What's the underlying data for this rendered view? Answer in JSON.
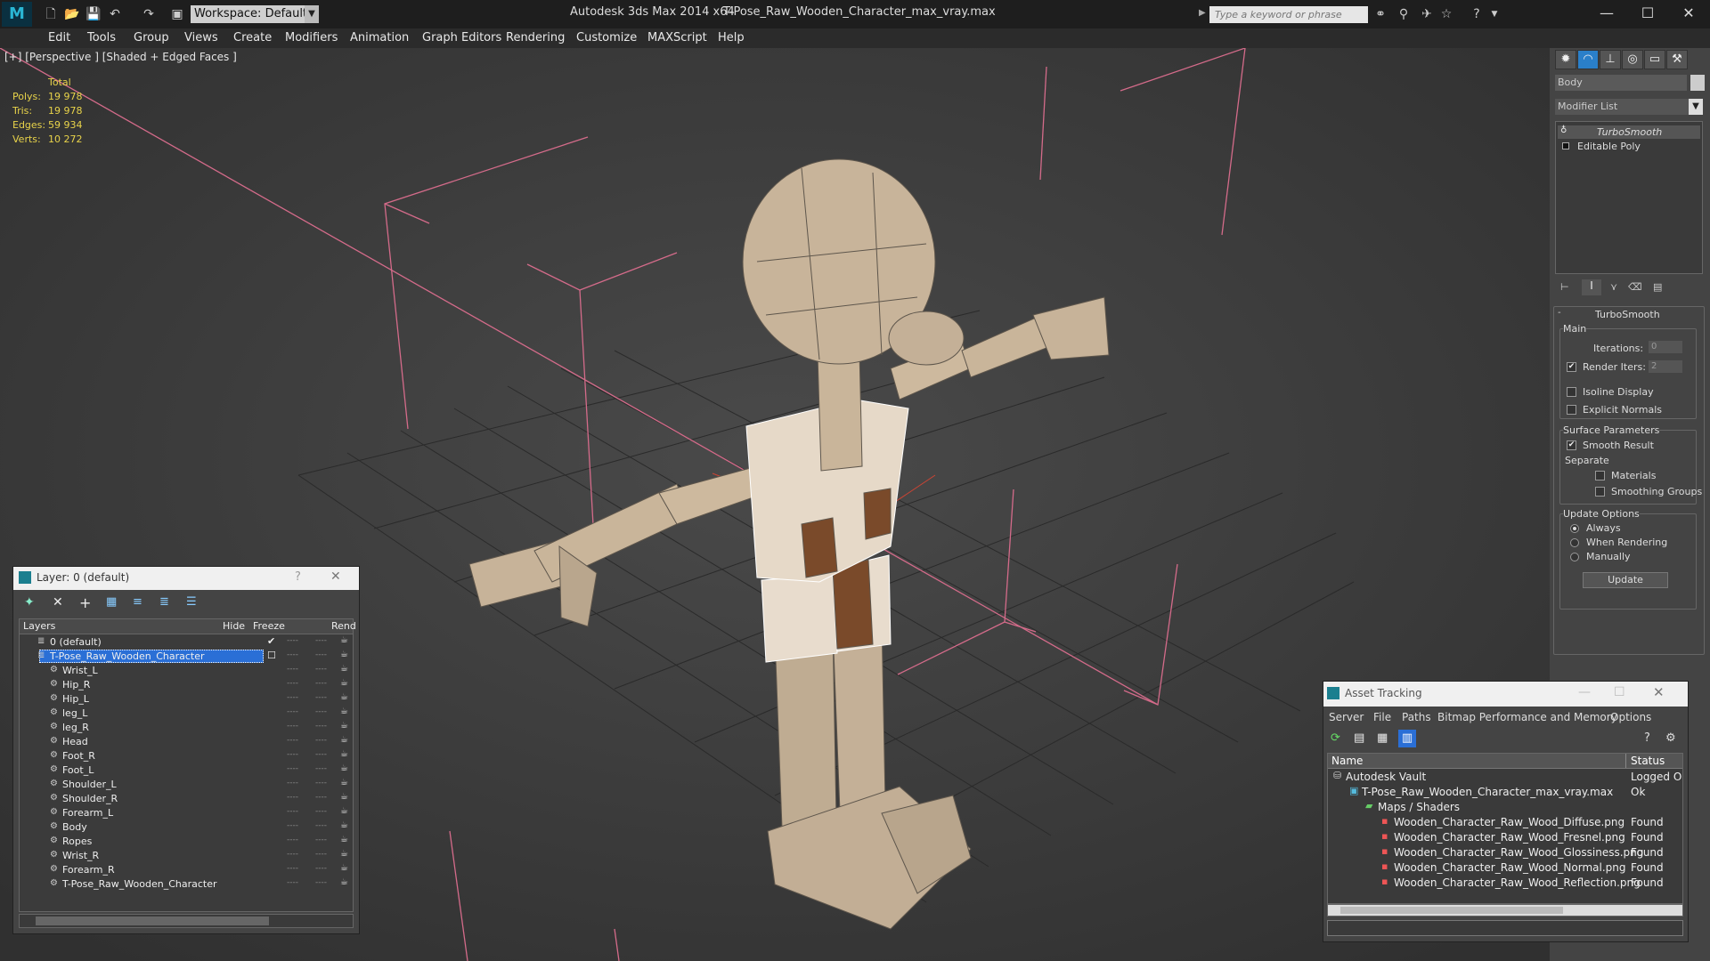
{
  "titlebar": {
    "app_title": "Autodesk 3ds Max 2014 x64",
    "file_title": "T-Pose_Raw_Wooden_Character_max_vray.max",
    "workspace_label": "Workspace: Default",
    "search_placeholder": "Type a keyword or phrase"
  },
  "menu": [
    "Edit",
    "Tools",
    "Group",
    "Views",
    "Create",
    "Modifiers",
    "Animation",
    "Graph Editors",
    "Rendering",
    "Customize",
    "MAXScript",
    "Help"
  ],
  "viewport": {
    "label": "[+] [Perspective ] [Shaded + Edged Faces ]",
    "stats": {
      "header": "Total",
      "rows": [
        {
          "label": "Polys:",
          "value": "19 978"
        },
        {
          "label": "Tris:",
          "value": "19 978"
        },
        {
          "label": "Edges:",
          "value": "59 934"
        },
        {
          "label": "Verts:",
          "value": "10 272"
        }
      ]
    }
  },
  "command_panel": {
    "object_name": "Body",
    "modifier_list_label": "Modifier List",
    "stack": [
      "TurboSmooth",
      "Editable Poly"
    ],
    "rollout_title": "TurboSmooth",
    "main_group": "Main",
    "iterations_label": "Iterations:",
    "iterations_value": "0",
    "render_iters_label": "Render Iters:",
    "render_iters_value": "2",
    "isoline_label": "Isoline Display",
    "explicit_normals_label": "Explicit Normals",
    "surface_params_label": "Surface Parameters",
    "smooth_result_label": "Smooth Result",
    "separate_label": "Separate",
    "materials_label": "Materials",
    "smoothing_groups_label": "Smoothing Groups",
    "update_options_label": "Update Options",
    "always_label": "Always",
    "when_rendering_label": "When Rendering",
    "manually_label": "Manually",
    "update_button": "Update"
  },
  "layer_window": {
    "title": "Layer: 0 (default)",
    "help": "?",
    "columns": {
      "layers": "Layers",
      "hide": "Hide",
      "freeze": "Freeze",
      "render": "Rend"
    },
    "layers": [
      {
        "name": "0 (default)",
        "level": 0,
        "selected": false,
        "checked": true
      },
      {
        "name": "T-Pose_Raw_Wooden_Character",
        "level": 0,
        "selected": true,
        "checked": false
      }
    ],
    "objects": [
      "Wrist_L",
      "Hip_R",
      "Hip_L",
      "leg_L",
      "leg_R",
      "Head",
      "Foot_R",
      "Foot_L",
      "Shoulder_L",
      "Shoulder_R",
      "Forearm_L",
      "Body",
      "Ropes",
      "Wrist_R",
      "Forearm_R",
      "T-Pose_Raw_Wooden_Character"
    ],
    "dash": "----"
  },
  "asset_window": {
    "title": "Asset Tracking",
    "menu": [
      "Server",
      "File",
      "Paths",
      "Bitmap Performance and Memory",
      "Options"
    ],
    "columns": {
      "name": "Name",
      "status": "Status"
    },
    "rows": [
      {
        "name": "Autodesk Vault",
        "status": "Logged Ou",
        "indent": 0,
        "icon": "vault-icon"
      },
      {
        "name": "T-Pose_Raw_Wooden_Character_max_vray.max",
        "status": "Ok",
        "indent": 1,
        "icon": "max-file-icon"
      },
      {
        "name": "Maps / Shaders",
        "status": "",
        "indent": 2,
        "icon": "folder-icon"
      },
      {
        "name": "Wooden_Character_Raw_Wood_Diffuse.png",
        "status": "Found",
        "indent": 3,
        "icon": "png-icon"
      },
      {
        "name": "Wooden_Character_Raw_Wood_Fresnel.png",
        "status": "Found",
        "indent": 3,
        "icon": "png-icon"
      },
      {
        "name": "Wooden_Character_Raw_Wood_Glossiness.png",
        "status": "Found",
        "indent": 3,
        "icon": "png-icon"
      },
      {
        "name": "Wooden_Character_Raw_Wood_Normal.png",
        "status": "Found",
        "indent": 3,
        "icon": "png-icon"
      },
      {
        "name": "Wooden_Character_Raw_Wood_Reflection.png",
        "status": "Found",
        "indent": 3,
        "icon": "png-icon"
      }
    ]
  },
  "colors": {
    "stats": "#e8d34a",
    "selection": "#2a6fd6",
    "bbox": "#d46b8a",
    "wood": "#c9b59a",
    "wood_dark": "#7a4a2a"
  }
}
